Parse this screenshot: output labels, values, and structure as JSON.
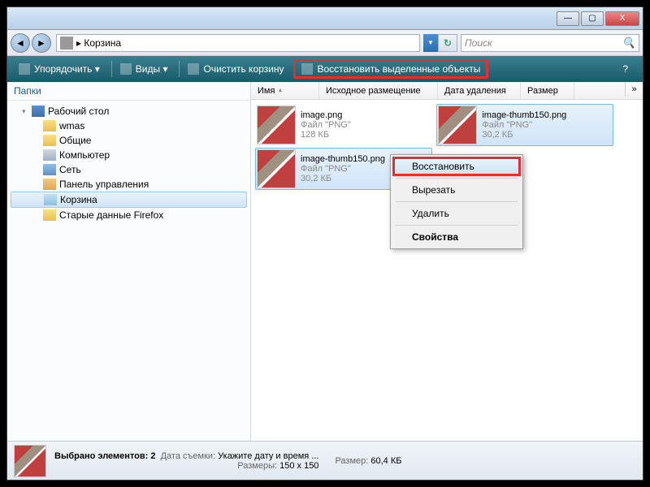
{
  "titlebar": {
    "min": "—",
    "max": "▢",
    "close": "X"
  },
  "nav": {
    "back": "◄",
    "fwd": "►",
    "path_sep": "▸",
    "location": "Корзина",
    "drop": "▼",
    "refresh": "↻",
    "search_placeholder": "Поиск",
    "search_icon": "🔍"
  },
  "toolbar": {
    "organize": "Упорядочить",
    "views": "Виды",
    "empty": "Очистить корзину",
    "restore": "Восстановить выделенные объекты",
    "help": "?"
  },
  "sidebar": {
    "header": "Папки",
    "root": "Рабочий стол",
    "items": [
      "wmas",
      "Общие",
      "Компьютер",
      "Сеть",
      "Панель управления",
      "Корзина",
      "Старые данные Firefox"
    ]
  },
  "columns": {
    "name": "Имя",
    "orig": "Исходное размещение",
    "deleted": "Дата удаления",
    "size": "Размер",
    "more": "»"
  },
  "files": [
    {
      "name": "image.png",
      "type": "Файл \"PNG\"",
      "size": "128 КБ",
      "selected": false
    },
    {
      "name": "image-thumb150.png",
      "type": "Файл \"PNG\"",
      "size": "30,2 КБ",
      "selected": true
    },
    {
      "name": "image-thumb150.png",
      "type": "Файл \"PNG\"",
      "size": "30,2 КБ",
      "selected": true
    }
  ],
  "context_menu": {
    "restore": "Восстановить",
    "cut": "Вырезать",
    "delete": "Удалить",
    "properties": "Свойства"
  },
  "status": {
    "selected": "Выбрано элементов: 2",
    "date_label": "Дата съемки:",
    "date_value": "Укажите дату и время ...",
    "dims_label": "Размеры:",
    "dims_value": "150 x 150",
    "size_label": "Размер:",
    "size_value": "60,4 КБ"
  }
}
